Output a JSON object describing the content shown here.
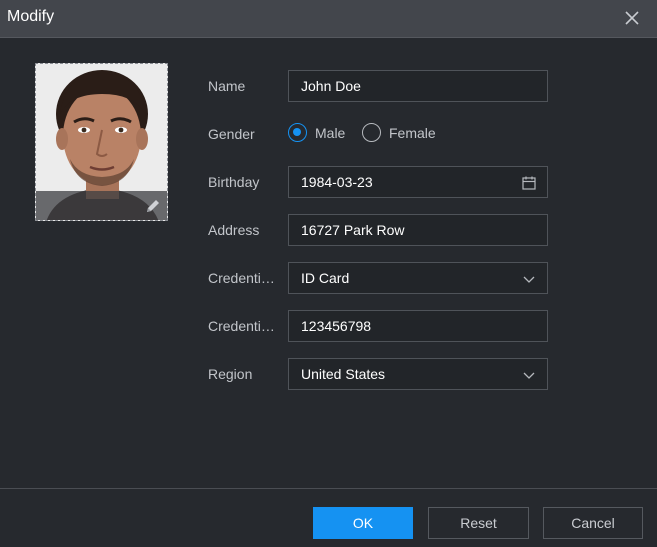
{
  "dialog": {
    "title": "Modify"
  },
  "photo": {
    "alt": "portrait"
  },
  "form": {
    "name": {
      "label": "Name",
      "value": "John Doe"
    },
    "gender": {
      "label": "Gender",
      "options": [
        "Male",
        "Female"
      ],
      "selected": "Male"
    },
    "birthday": {
      "label": "Birthday",
      "value": "1984-03-23"
    },
    "address": {
      "label": "Address",
      "value": "16727 Park Row"
    },
    "credential_type": {
      "label": "Credenti…",
      "value": "ID Card"
    },
    "credential_no": {
      "label": "Credenti…",
      "value": "123456798"
    },
    "region": {
      "label": "Region",
      "value": "United States"
    }
  },
  "buttons": {
    "ok": "OK",
    "reset": "Reset",
    "cancel": "Cancel"
  },
  "colors": {
    "accent": "#1592f2",
    "background": "#26292e",
    "titlebar": "#43464c"
  },
  "icons": {
    "close": "close-icon",
    "edit": "pencil-icon",
    "calendar": "calendar-icon",
    "dropdown": "chevron-down-icon"
  }
}
